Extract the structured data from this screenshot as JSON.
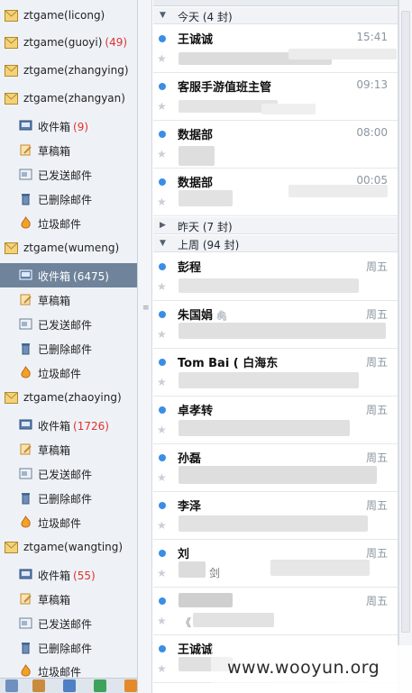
{
  "accounts": [
    {
      "name": "ztgame(licong)",
      "count": ""
    },
    {
      "name": "ztgame(guoyi)",
      "count": "(49)"
    },
    {
      "name": "ztgame(zhangying)",
      "count": ""
    },
    {
      "name": "ztgame(zhangyan)",
      "count": ""
    },
    {
      "name": "ztgame(wumeng)",
      "count": ""
    },
    {
      "name": "ztgame(zhaoying)",
      "count": ""
    },
    {
      "name": "ztgame(wangting)",
      "count": ""
    }
  ],
  "folders": {
    "zhangyan": [
      {
        "label": "收件箱",
        "count": "(9)"
      },
      {
        "label": "草稿箱",
        "count": ""
      },
      {
        "label": "已发送邮件",
        "count": ""
      },
      {
        "label": "已删除邮件",
        "count": ""
      },
      {
        "label": "垃圾邮件",
        "count": ""
      }
    ],
    "wumeng": [
      {
        "label": "收件箱",
        "count": "(6475)"
      },
      {
        "label": "草稿箱",
        "count": ""
      },
      {
        "label": "已发送邮件",
        "count": ""
      },
      {
        "label": "已删除邮件",
        "count": ""
      },
      {
        "label": "垃圾邮件",
        "count": ""
      }
    ],
    "zhaoying": [
      {
        "label": "收件箱",
        "count": "(1726)"
      },
      {
        "label": "草稿箱",
        "count": ""
      },
      {
        "label": "已发送邮件",
        "count": ""
      },
      {
        "label": "已删除邮件",
        "count": ""
      },
      {
        "label": "垃圾邮件",
        "count": ""
      }
    ],
    "wangting": [
      {
        "label": "收件箱",
        "count": "(55)"
      },
      {
        "label": "草稿箱",
        "count": ""
      },
      {
        "label": "已发送邮件",
        "count": ""
      },
      {
        "label": "已删除邮件",
        "count": ""
      },
      {
        "label": "垃圾邮件",
        "count": ""
      }
    ]
  },
  "groups": [
    {
      "label": "今天 (4 封)",
      "expanded": true
    },
    {
      "label": "昨天 (7 封)",
      "expanded": false
    },
    {
      "label": "上周 (94 封)",
      "expanded": true
    }
  ],
  "mails_today": [
    {
      "sender": "王诚诚",
      "date": "15:41"
    },
    {
      "sender": "客服手游值班主管",
      "date": "09:13"
    },
    {
      "sender": "数据部",
      "date": "08:00"
    },
    {
      "sender": "数据部",
      "date": "00:05"
    }
  ],
  "mails_lastweek": [
    {
      "sender": "彭程",
      "date": "周五"
    },
    {
      "sender": "朱国娟",
      "date": "周五"
    },
    {
      "sender": "Tom Bai ( 白海东",
      "date": "周五"
    },
    {
      "sender": "卓孝转",
      "date": "周五"
    },
    {
      "sender": "孙磊",
      "date": "周五"
    },
    {
      "sender": "李泽",
      "date": "周五"
    },
    {
      "sender": "刘",
      "date": "周五"
    },
    {
      "sender": "",
      "date": "周五"
    },
    {
      "sender": "王诚诚",
      "date": ""
    }
  ],
  "snippet_fragments": {
    "mail_12": "剑",
    "mail_13": "《"
  },
  "watermark": "www.wooyun.org",
  "colors": {
    "unread": "#3a8ee6",
    "count_red": "#e0312e",
    "selected_bg": "#6f839b"
  }
}
